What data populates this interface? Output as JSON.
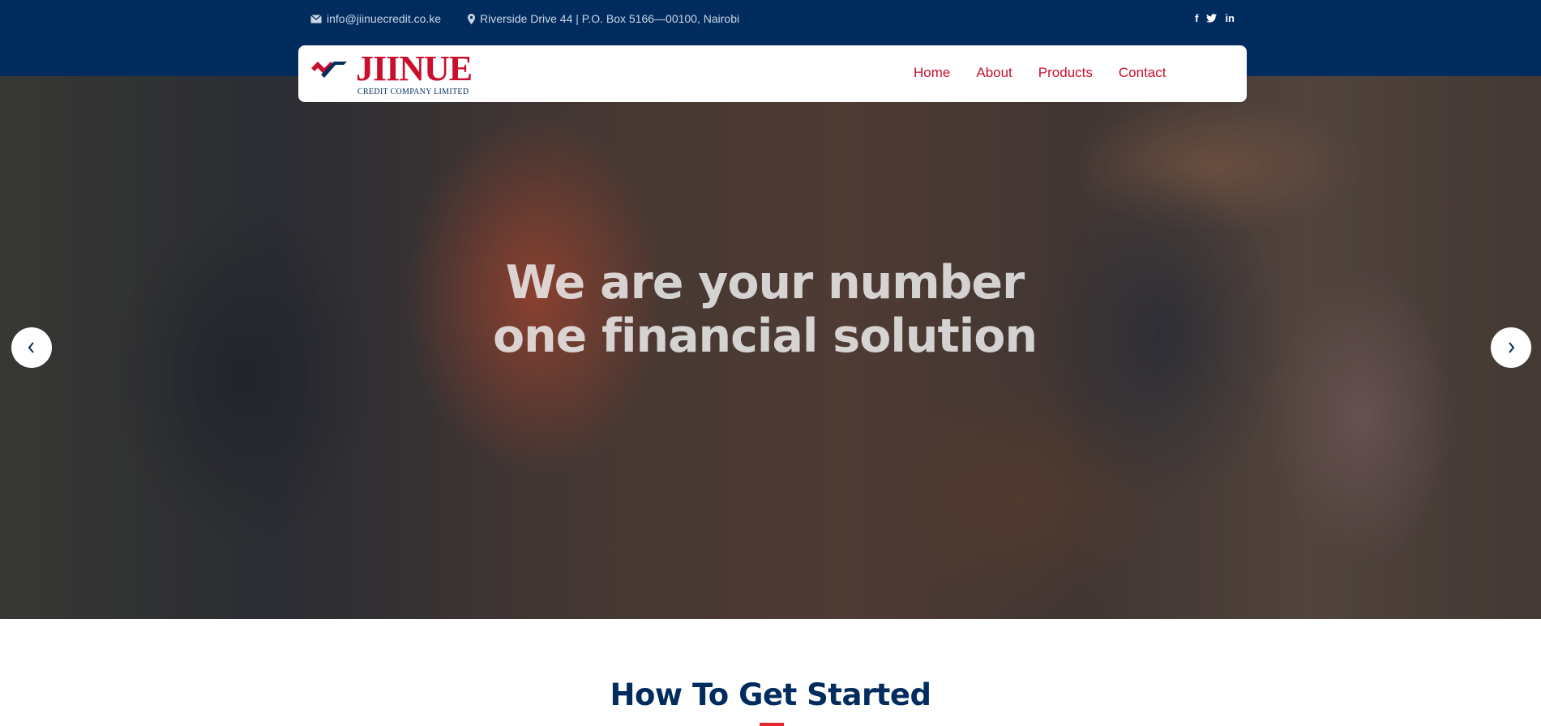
{
  "topbar": {
    "email": "info@jiinuecredit.co.ke",
    "address": "Riverside Drive 44 | P.O. Box 5166—00100, Nairobi",
    "social": [
      {
        "icon": "facebook-icon",
        "glyph": "f"
      },
      {
        "icon": "twitter-icon",
        "glyph": "🐦"
      },
      {
        "icon": "linkedin-icon",
        "glyph": "in"
      }
    ]
  },
  "logo": {
    "word": "JIINUE",
    "sub": "CREDIT COMPANY LIMITED"
  },
  "nav": {
    "items": [
      "Home",
      "About",
      "Products",
      "Contact"
    ]
  },
  "hero": {
    "title_line1": "We are your number",
    "title_line2": "one financial solution"
  },
  "section": {
    "title": "How To Get Started"
  },
  "colors": {
    "navy": "#022c5e",
    "brand_red": "#c8102e",
    "accent_red": "#e3262f"
  }
}
